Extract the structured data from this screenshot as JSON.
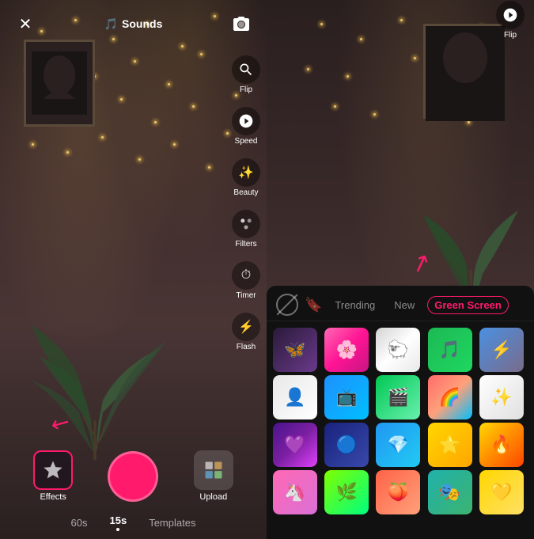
{
  "left": {
    "close_label": "✕",
    "sounds_label": "Sounds",
    "flip_label": "Flip",
    "speed_label": "Speed",
    "beauty_label": "Beauty",
    "filters_label": "Filters",
    "timer_label": "Timer",
    "flash_label": "Flash",
    "effects_label": "Effects",
    "upload_label": "Upload",
    "durations": [
      "60s",
      "15s",
      "Templates"
    ],
    "active_duration": "15s"
  },
  "right": {
    "flip_label": "Flip",
    "effects_panel": {
      "tabs": [
        "no-effect",
        "bookmark",
        "Trending",
        "New",
        "Green Screen"
      ],
      "active_tab": "Green Screen",
      "effects": [
        {
          "id": 1,
          "emoji": "🦋",
          "color": "eff-1"
        },
        {
          "id": 2,
          "emoji": "🌸",
          "color": "eff-2"
        },
        {
          "id": 3,
          "emoji": "🐑",
          "color": "eff-3"
        },
        {
          "id": 4,
          "emoji": "🎵",
          "color": "eff-4"
        },
        {
          "id": 5,
          "emoji": "⚡",
          "color": "eff-5"
        },
        {
          "id": 6,
          "emoji": "👤",
          "color": "eff-6"
        },
        {
          "id": 7,
          "emoji": "📺",
          "color": "eff-7"
        },
        {
          "id": 8,
          "emoji": "🎬",
          "color": "eff-8"
        },
        {
          "id": 9,
          "emoji": "🌈",
          "color": "eff-9"
        },
        {
          "id": 10,
          "emoji": "✨",
          "color": "eff-10"
        },
        {
          "id": 11,
          "emoji": "💜",
          "color": "eff-11"
        },
        {
          "id": 12,
          "emoji": "🔵",
          "color": "eff-12"
        },
        {
          "id": 13,
          "emoji": "💎",
          "color": "eff-13"
        },
        {
          "id": 14,
          "emoji": "⭐",
          "color": "eff-14"
        },
        {
          "id": 15,
          "emoji": "🔥",
          "color": "eff-15"
        },
        {
          "id": 16,
          "emoji": "🦄",
          "color": "eff-16"
        },
        {
          "id": 17,
          "emoji": "🌿",
          "color": "eff-17"
        },
        {
          "id": 18,
          "emoji": "🍑",
          "color": "eff-18"
        },
        {
          "id": 19,
          "emoji": "🎭",
          "color": "eff-19"
        },
        {
          "id": 20,
          "emoji": "💛",
          "color": "eff-20"
        }
      ]
    }
  }
}
